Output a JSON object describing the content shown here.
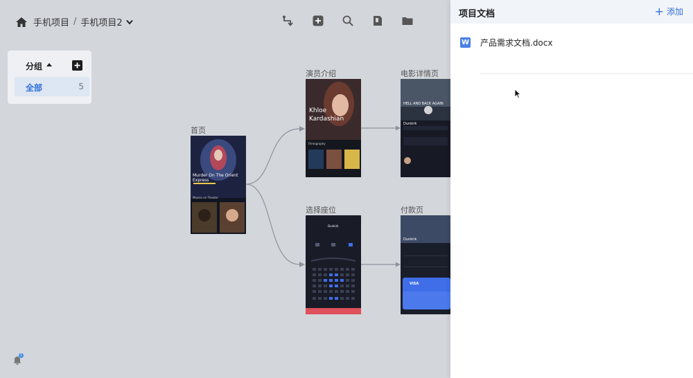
{
  "breadcrumb": {
    "home_icon": "home-icon",
    "project_root": "手机项目",
    "separator": "/",
    "project_current": "手机项目2"
  },
  "toolbar": {
    "icons": [
      "link-connector-icon",
      "add-square-icon",
      "search-icon",
      "book-icon",
      "folder-icon"
    ]
  },
  "groups": {
    "title": "分组",
    "items": [
      {
        "label": "全部",
        "count": "5"
      }
    ]
  },
  "frames": [
    {
      "label": "首页"
    },
    {
      "label": "演员介绍"
    },
    {
      "label": "电影详情页"
    },
    {
      "label": "选择座位"
    },
    {
      "label": "付款页"
    }
  ],
  "screens": {
    "home": {
      "headline": "Murder On The Orient Express",
      "section": "Movies on Theater"
    },
    "actor": {
      "name": "Khloe Kardashian",
      "section": "Filmography"
    },
    "detail": {
      "title": "HELL AND BACK AGAIN",
      "movie": "Dunkirk"
    },
    "seat": {
      "movie": "Dunkirk"
    },
    "pay": {
      "movie": "Dunkirk",
      "card": "VISA"
    }
  },
  "panel": {
    "title": "项目文档",
    "add_label": "添加",
    "documents": [
      {
        "badge": "W",
        "name": "产品需求文档.docx"
      }
    ]
  },
  "notifications": {
    "badge": "1"
  },
  "colors": {
    "accent": "#2f6fd8",
    "canvas": "#d3d6db"
  }
}
